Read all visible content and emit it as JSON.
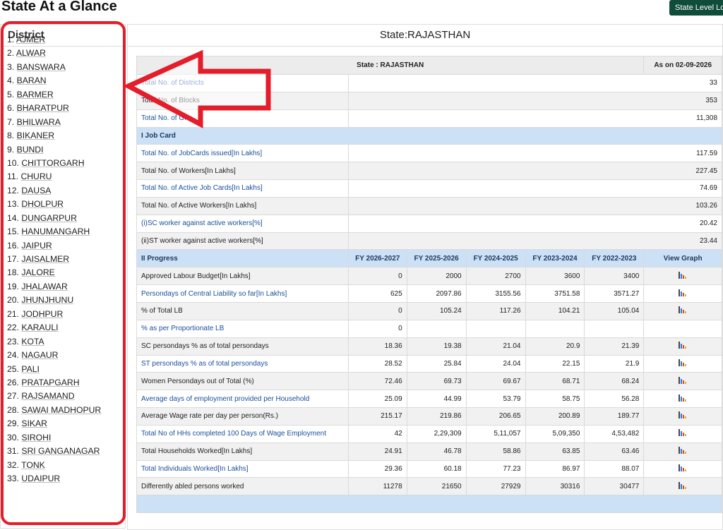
{
  "header": {
    "title": "State At a Glance",
    "button_label": "State Level Log"
  },
  "district_panel": {
    "heading": "District",
    "items": [
      {
        "num": "1.",
        "name": "AJMER"
      },
      {
        "num": "2.",
        "name": "ALWAR"
      },
      {
        "num": "3.",
        "name": "BANSWARA"
      },
      {
        "num": "4.",
        "name": "BARAN"
      },
      {
        "num": "5.",
        "name": "BARMER"
      },
      {
        "num": "6.",
        "name": "BHARATPUR"
      },
      {
        "num": "7.",
        "name": "BHILWARA"
      },
      {
        "num": "8.",
        "name": "BIKANER"
      },
      {
        "num": "9.",
        "name": "BUNDI"
      },
      {
        "num": "10.",
        "name": "CHITTORGARH"
      },
      {
        "num": "11.",
        "name": "CHURU"
      },
      {
        "num": "12.",
        "name": "DAUSA"
      },
      {
        "num": "13.",
        "name": "DHOLPUR"
      },
      {
        "num": "14.",
        "name": "DUNGARPUR"
      },
      {
        "num": "15.",
        "name": "HANUMANGARH"
      },
      {
        "num": "16.",
        "name": "JAIPUR"
      },
      {
        "num": "17.",
        "name": "JAISALMER"
      },
      {
        "num": "18.",
        "name": "JALORE"
      },
      {
        "num": "19.",
        "name": "JHALAWAR"
      },
      {
        "num": "20.",
        "name": "JHUNJHUNU"
      },
      {
        "num": "21.",
        "name": "JODHPUR"
      },
      {
        "num": "22.",
        "name": "KARAULI"
      },
      {
        "num": "23.",
        "name": "KOTA"
      },
      {
        "num": "24.",
        "name": "NAGAUR"
      },
      {
        "num": "25.",
        "name": "PALI"
      },
      {
        "num": "26.",
        "name": "PRATAPGARH"
      },
      {
        "num": "27.",
        "name": "RAJSAMAND"
      },
      {
        "num": "28.",
        "name": "SAWAI MADHOPUR"
      },
      {
        "num": "29.",
        "name": "SIKAR"
      },
      {
        "num": "30.",
        "name": "SIROHI"
      },
      {
        "num": "31.",
        "name": "SRI GANGANAGAR"
      },
      {
        "num": "32.",
        "name": "TONK"
      },
      {
        "num": "33.",
        "name": "UDAIPUR"
      }
    ]
  },
  "state_panel": {
    "heading": "State:RAJASTHAN",
    "table_header": {
      "state_label": "State : RAJASTHAN",
      "as_on": "As on 02-09-2026"
    },
    "summary_rows": [
      {
        "label": "Total No. of Districts",
        "value": "33",
        "link": true
      },
      {
        "label": "Total No. of Blocks",
        "value": "353",
        "link": false
      },
      {
        "label": "Total No. of GPs",
        "value": "11,308",
        "link": true
      }
    ],
    "job_card_section": "I Job Card",
    "job_card_rows": [
      {
        "label": "Total No. of JobCards issued[In Lakhs]",
        "value": "117.59",
        "link": true
      },
      {
        "label": "Total No. of Workers[In Lakhs]",
        "value": "227.45",
        "link": false
      },
      {
        "label": "Total No. of Active Job Cards[In Lakhs]",
        "value": "74.69",
        "link": true
      },
      {
        "label": "Total No. of Active Workers[In Lakhs]",
        "value": "103.26",
        "link": false
      },
      {
        "label": "(i)SC worker against active workers[%]",
        "value": "20.42",
        "link": true
      },
      {
        "label": "(ii)ST worker against active workers[%]",
        "value": "23.44",
        "link": false
      }
    ],
    "progress_section": "II Progress",
    "progress_columns": [
      "FY 2026-2027",
      "FY 2025-2026",
      "FY 2024-2025",
      "FY 2023-2024",
      "FY 2022-2023",
      "View Graph"
    ],
    "progress_rows": [
      {
        "label": "Approved Labour Budget[In Lakhs]",
        "values": [
          "0",
          "2000",
          "2700",
          "3600",
          "3400"
        ],
        "graph": true,
        "link": false
      },
      {
        "label": "Persondays of Central Liability so far[In Lakhs]",
        "values": [
          "625",
          "2097.86",
          "3155.56",
          "3751.58",
          "3571.27"
        ],
        "graph": true,
        "link": true
      },
      {
        "label": "% of Total LB",
        "values": [
          "0",
          "105.24",
          "117.26",
          "104.21",
          "105.04"
        ],
        "graph": true,
        "link": false
      },
      {
        "label": "% as per Proportionate LB",
        "values": [
          "0",
          "",
          "",
          "",
          ""
        ],
        "graph": false,
        "link": true
      },
      {
        "label": "SC persondays % as of total persondays",
        "values": [
          "18.36",
          "19.38",
          "21.04",
          "20.9",
          "21.39"
        ],
        "graph": true,
        "link": false
      },
      {
        "label": "ST persondays % as of total persondays",
        "values": [
          "28.52",
          "25.84",
          "24.04",
          "22.15",
          "21.9"
        ],
        "graph": true,
        "link": true
      },
      {
        "label": "Women Persondays out of Total (%)",
        "values": [
          "72.46",
          "69.73",
          "69.67",
          "68.71",
          "68.24"
        ],
        "graph": true,
        "link": false
      },
      {
        "label": "Average days of employment provided per Household",
        "values": [
          "25.09",
          "44.99",
          "53.79",
          "58.75",
          "56.28"
        ],
        "graph": true,
        "link": true
      },
      {
        "label": "Average Wage rate per day per person(Rs.)",
        "values": [
          "215.17",
          "219.86",
          "206.65",
          "200.89",
          "189.77"
        ],
        "graph": true,
        "link": false
      },
      {
        "label": "Total No of HHs completed 100 Days of Wage Employment",
        "values": [
          "42",
          "2,29,309",
          "5,11,057",
          "5,09,350",
          "4,53,482"
        ],
        "graph": true,
        "link": true
      },
      {
        "label": "Total Households Worked[In Lakhs]",
        "values": [
          "24.91",
          "46.78",
          "58.86",
          "63.85",
          "63.46"
        ],
        "graph": true,
        "link": false
      },
      {
        "label": "Total Individuals Worked[In Lakhs]",
        "values": [
          "29.36",
          "60.18",
          "77.23",
          "86.97",
          "88.07"
        ],
        "graph": true,
        "link": true
      },
      {
        "label": "Differently abled persons worked",
        "values": [
          "11278",
          "21650",
          "27929",
          "30316",
          "30477"
        ],
        "graph": true,
        "link": false
      }
    ]
  },
  "colors": {
    "annotation_red": "#e51c2a",
    "section_blue": "#cce0f6",
    "link_blue": "#1a4f9c",
    "button_green": "#0f4c3a"
  }
}
